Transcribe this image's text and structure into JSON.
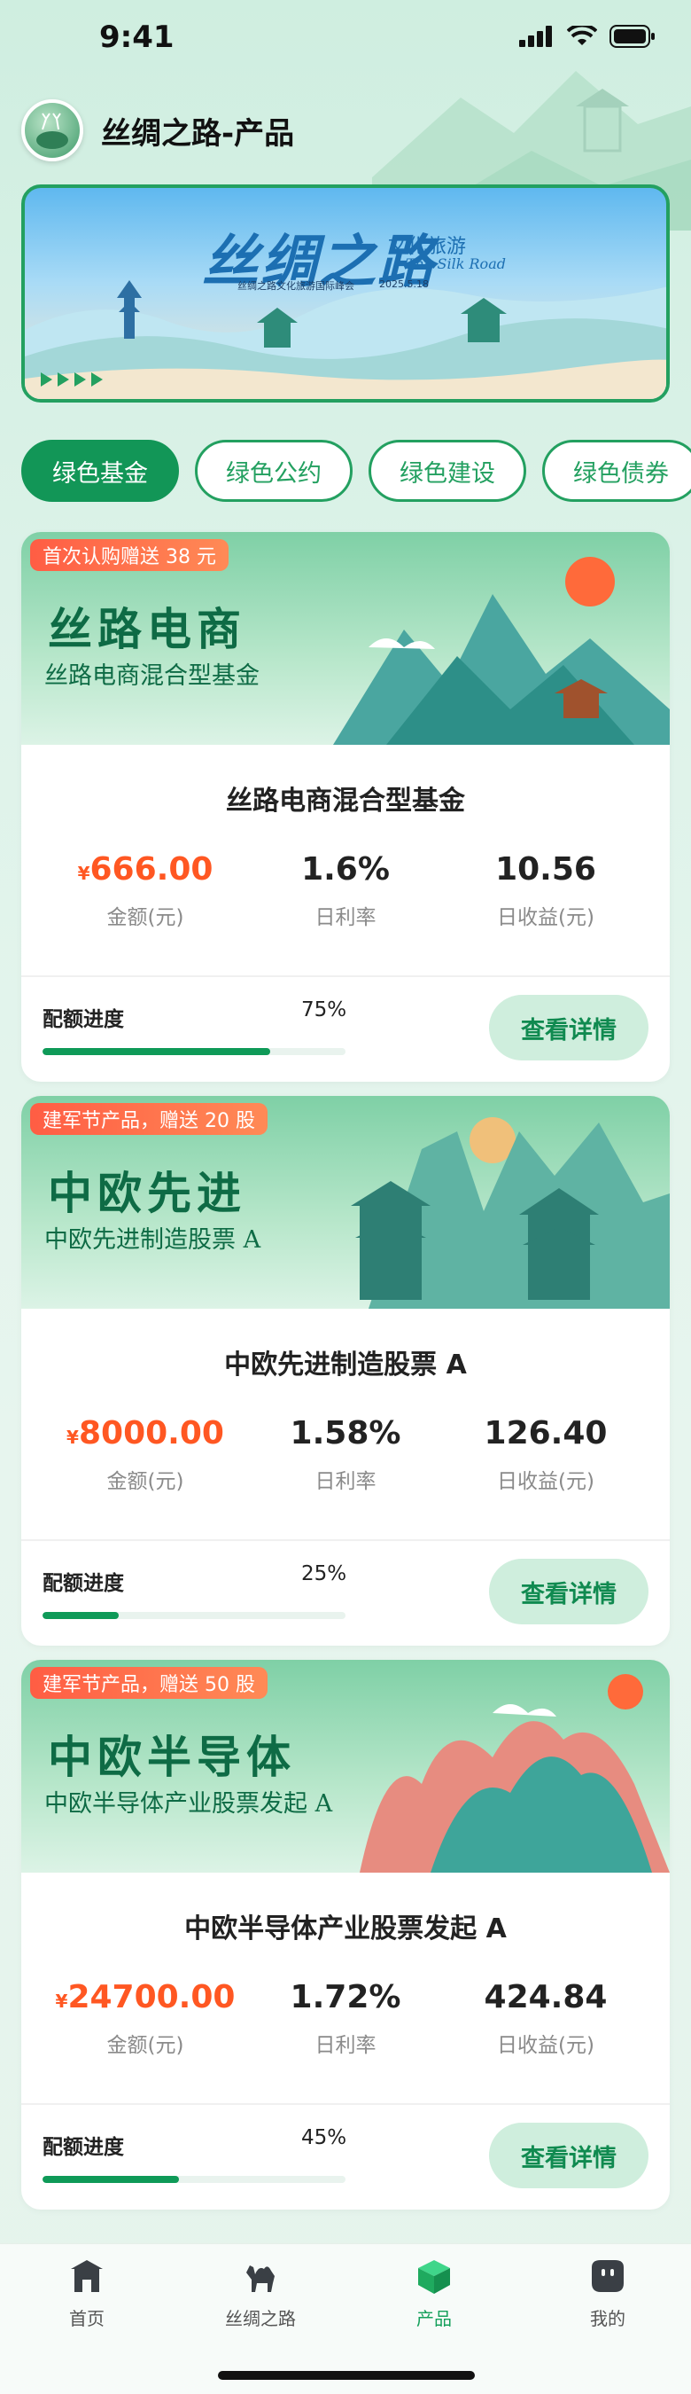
{
  "status_bar": {
    "time": "9:41"
  },
  "header": {
    "title": "丝绸之路-产品"
  },
  "banner": {
    "title": "丝绸之路",
    "subtitle_cn": "文化旅游",
    "subtitle_en": "The Silk Road",
    "event": "丝绸之路文化旅游国际峰会",
    "date": "2025.5.18"
  },
  "tabs": [
    {
      "label": "绿色基金",
      "active": true
    },
    {
      "label": "绿色公约",
      "active": false
    },
    {
      "label": "绿色建设",
      "active": false
    },
    {
      "label": "绿色债券",
      "active": false
    }
  ],
  "products": [
    {
      "promo": "首次认购赠送 38 元",
      "hero_title": "丝路电商",
      "hero_subtitle": "丝路电商混合型基金",
      "name": "丝路电商混合型基金",
      "amount": "666.00",
      "currency": "¥",
      "amount_label": "金额(元)",
      "rate": "1.6%",
      "rate_label": "日利率",
      "income": "10.56",
      "income_label": "日收益(元)",
      "quota_label": "配额进度",
      "quota_pct_text": "75%",
      "quota_pct": 75,
      "button": "查看详情"
    },
    {
      "promo": "建军节产品，赠送 20 股",
      "hero_title": "中欧先进",
      "hero_subtitle": "中欧先进制造股票 A",
      "name": "中欧先进制造股票 A",
      "amount": "8000.00",
      "currency": "¥",
      "amount_label": "金额(元)",
      "rate": "1.58%",
      "rate_label": "日利率",
      "income": "126.40",
      "income_label": "日收益(元)",
      "quota_label": "配额进度",
      "quota_pct_text": "25%",
      "quota_pct": 25,
      "button": "查看详情"
    },
    {
      "promo": "建军节产品，赠送 50 股",
      "hero_title": "中欧半导体",
      "hero_subtitle": "中欧半导体产业股票发起 A",
      "name": "中欧半导体产业股票发起 A",
      "amount": "24700.00",
      "currency": "¥",
      "amount_label": "金额(元)",
      "rate": "1.72%",
      "rate_label": "日利率",
      "income": "424.84",
      "income_label": "日收益(元)",
      "quota_label": "配额进度",
      "quota_pct_text": "45%",
      "quota_pct": 45,
      "button": "查看详情"
    }
  ],
  "tabbar": [
    {
      "label": "首页",
      "icon": "home-gate-icon",
      "active": false
    },
    {
      "label": "丝绸之路",
      "icon": "camel-icon",
      "active": false
    },
    {
      "label": "产品",
      "icon": "cube-icon",
      "active": true
    },
    {
      "label": "我的",
      "icon": "profile-icon",
      "active": false
    }
  ],
  "colors": {
    "primary": "#129657",
    "accent_red": "#ff5722",
    "promo": "#ff6a4a"
  }
}
